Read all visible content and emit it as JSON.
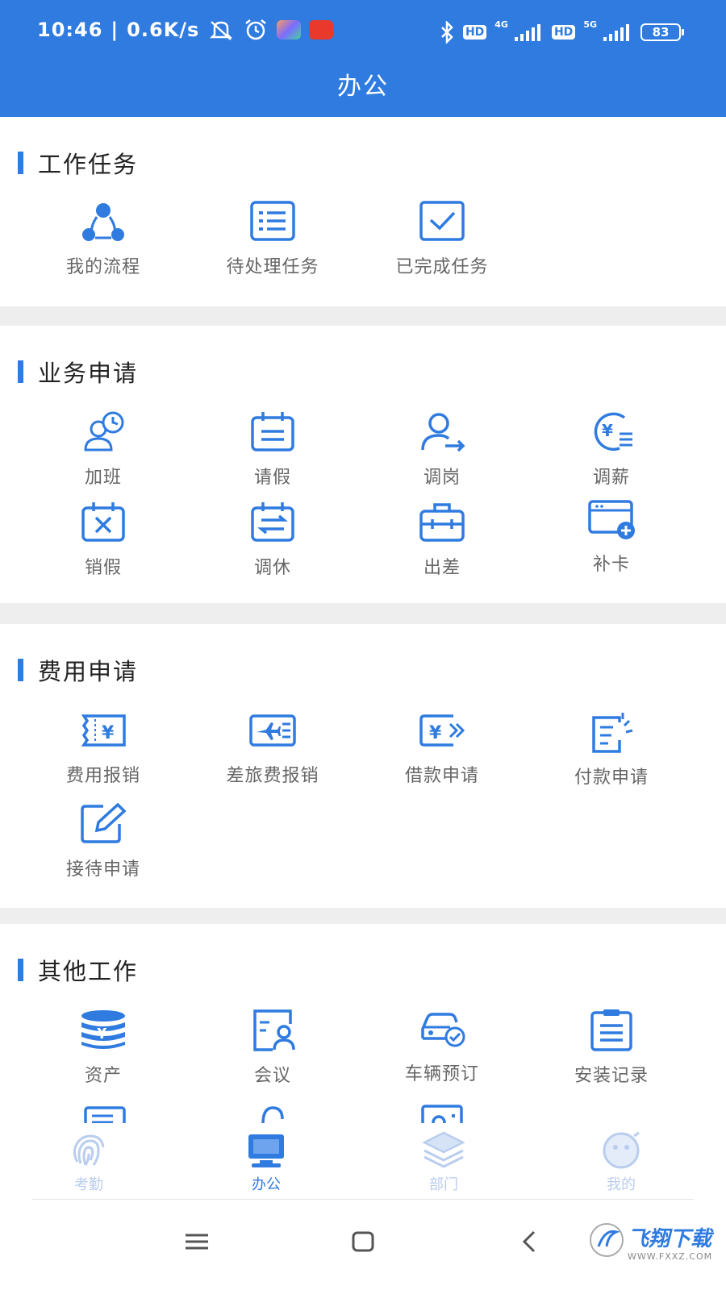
{
  "status_bar": {
    "time": "10:46",
    "net_speed": "0.6K/s",
    "hd1": "HD",
    "sig1": "4G",
    "hd2": "HD",
    "sig2": "5G",
    "battery": "83"
  },
  "header": {
    "title": "办公"
  },
  "sections": [
    {
      "title": "工作任务",
      "items": [
        {
          "label": "我的流程",
          "icon": "flow-icon"
        },
        {
          "label": "待处理任务",
          "icon": "list-icon"
        },
        {
          "label": "已完成任务",
          "icon": "check-icon"
        }
      ]
    },
    {
      "title": "业务申请",
      "items": [
        {
          "label": "加班",
          "icon": "overtime-icon"
        },
        {
          "label": "请假",
          "icon": "calendar-icon"
        },
        {
          "label": "调岗",
          "icon": "transfer-icon"
        },
        {
          "label": "调薪",
          "icon": "salary-icon"
        },
        {
          "label": "销假",
          "icon": "cancel-leave-icon"
        },
        {
          "label": "调休",
          "icon": "swap-icon"
        },
        {
          "label": "出差",
          "icon": "briefcase-icon"
        },
        {
          "label": "补卡",
          "icon": "card-icon"
        }
      ]
    },
    {
      "title": "费用申请",
      "items": [
        {
          "label": "费用报销",
          "icon": "receipt-icon"
        },
        {
          "label": "差旅费报销",
          "icon": "plane-ticket-icon"
        },
        {
          "label": "借款申请",
          "icon": "loan-icon"
        },
        {
          "label": "付款申请",
          "icon": "payment-icon"
        },
        {
          "label": "接待申请",
          "icon": "edit-icon"
        }
      ]
    },
    {
      "title": "其他工作",
      "items": [
        {
          "label": "资产",
          "icon": "coins-icon"
        },
        {
          "label": "会议",
          "icon": "meeting-icon"
        },
        {
          "label": "车辆预订",
          "icon": "car-icon"
        },
        {
          "label": "安装记录",
          "icon": "clipboard-icon"
        }
      ]
    }
  ],
  "tabbar": [
    {
      "label": "考勤",
      "icon": "fingerprint-icon",
      "active": false
    },
    {
      "label": "办公",
      "icon": "computer-icon",
      "active": true
    },
    {
      "label": "部门",
      "icon": "layers-icon",
      "active": false
    },
    {
      "label": "我的",
      "icon": "face-icon",
      "active": false
    }
  ],
  "watermark": {
    "text": "飞翔下载",
    "sub": "WWW.FXXZ.COM"
  },
  "colors": {
    "accent": "#2f7be0",
    "inactive_tab": "#b9cdee",
    "divider": "#eeeeee"
  }
}
